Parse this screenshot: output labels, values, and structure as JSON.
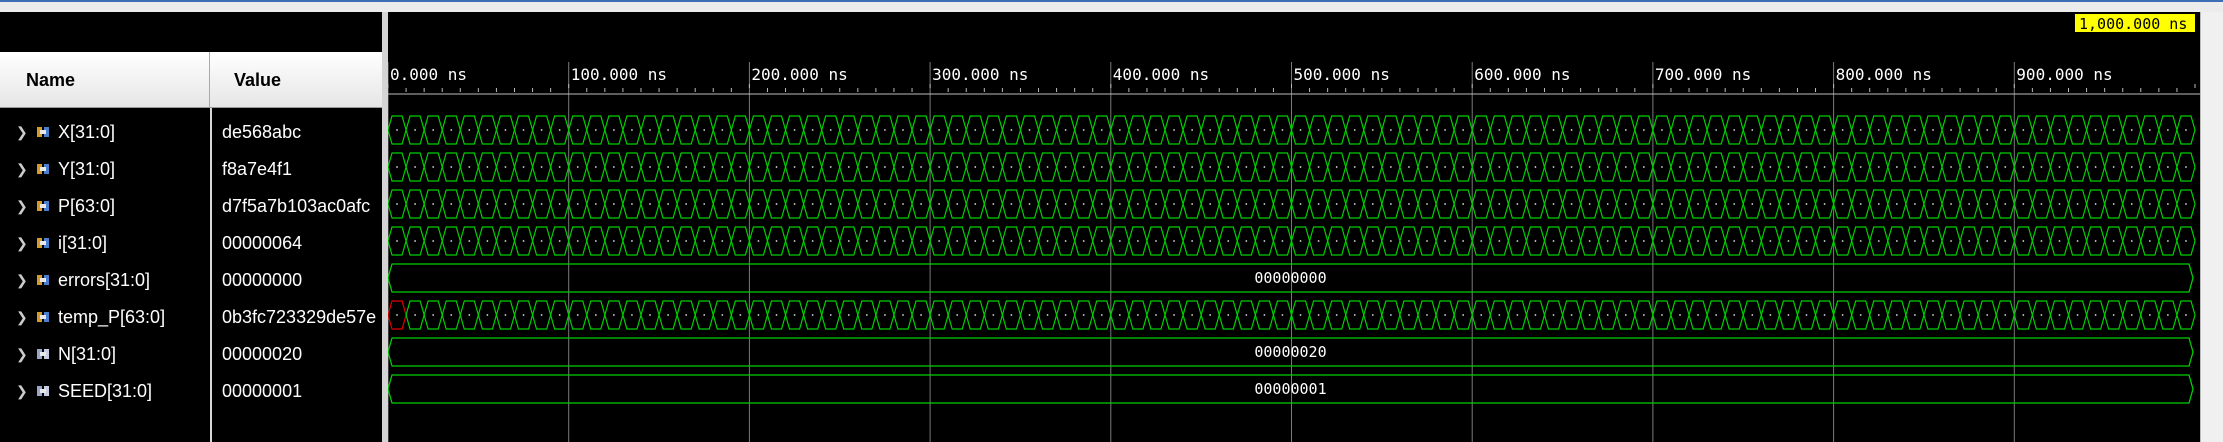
{
  "columns": {
    "name": "Name",
    "value": "Value"
  },
  "signals": [
    {
      "name": "X[31:0]",
      "value": "de568abc",
      "kind": "bus-toggling",
      "icon": "bus-signal-icon"
    },
    {
      "name": "Y[31:0]",
      "value": "f8a7e4f1",
      "kind": "bus-toggling",
      "icon": "bus-signal-icon"
    },
    {
      "name": "P[63:0]",
      "value": "d7f5a7b103ac0afc",
      "kind": "bus-toggling",
      "icon": "bus-signal-icon"
    },
    {
      "name": "i[31:0]",
      "value": "00000064",
      "kind": "bus-toggling",
      "icon": "bus-signal-icon"
    },
    {
      "name": "errors[31:0]",
      "value": "00000000",
      "kind": "bus-constant",
      "icon": "bus-signal-icon"
    },
    {
      "name": "temp_P[63:0]",
      "value": "0b3fc723329de57e",
      "kind": "bus-toggling-first-undefined",
      "icon": "bus-signal-icon"
    },
    {
      "name": "N[31:0]",
      "value": "00000020",
      "kind": "bus-constant",
      "icon": "parameter-icon"
    },
    {
      "name": "SEED[31:0]",
      "value": "00000001",
      "kind": "bus-constant",
      "icon": "parameter-icon"
    }
  ],
  "timeline": {
    "unit": "ns",
    "start": 0,
    "end": 1000,
    "major_tick_step": 100,
    "labels": [
      "0.000 ns",
      "100.000 ns",
      "200.000 ns",
      "300.000 ns",
      "400.000 ns",
      "500.000 ns",
      "600.000 ns",
      "700.000 ns",
      "800.000 ns",
      "900.000 ns"
    ],
    "cursor_label": "1,000.000 ns",
    "cursor_time": 1000,
    "transition_period": 10
  },
  "colors": {
    "wave": "#00d000",
    "undefined": "#e00000",
    "grid": "#7a7a7a",
    "cursor_bg": "#ffff00",
    "text": "#ffffff"
  }
}
